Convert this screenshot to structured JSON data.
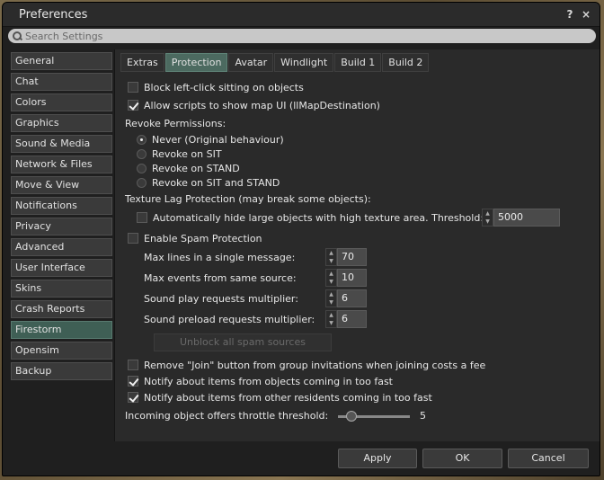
{
  "window": {
    "title": "Preferences",
    "help_label": "?",
    "close_label": "×"
  },
  "search": {
    "placeholder": "Search Settings"
  },
  "sidebar": {
    "items": [
      {
        "label": "General"
      },
      {
        "label": "Chat"
      },
      {
        "label": "Colors"
      },
      {
        "label": "Graphics"
      },
      {
        "label": "Sound & Media"
      },
      {
        "label": "Network & Files"
      },
      {
        "label": "Move & View"
      },
      {
        "label": "Notifications"
      },
      {
        "label": "Privacy"
      },
      {
        "label": "Advanced"
      },
      {
        "label": "User Interface"
      },
      {
        "label": "Skins"
      },
      {
        "label": "Crash Reports"
      },
      {
        "label": "Firestorm"
      },
      {
        "label": "Opensim"
      },
      {
        "label": "Backup"
      }
    ],
    "selected": "Firestorm"
  },
  "tabs": {
    "items": [
      {
        "label": "Extras"
      },
      {
        "label": "Protection"
      },
      {
        "label": "Avatar"
      },
      {
        "label": "Windlight"
      },
      {
        "label": "Build 1"
      },
      {
        "label": "Build 2"
      }
    ],
    "selected": "Protection"
  },
  "protection": {
    "block_left_click": {
      "label": "Block left-click sitting on objects",
      "checked": false
    },
    "allow_map_ui": {
      "label": "Allow scripts to show map UI (llMapDestination)",
      "checked": true
    },
    "revoke_heading": "Revoke Permissions:",
    "revoke_options": [
      {
        "label": "Never (Original behaviour)",
        "selected": true
      },
      {
        "label": "Revoke on SIT",
        "selected": false
      },
      {
        "label": "Revoke on STAND",
        "selected": false
      },
      {
        "label": "Revoke on SIT and STAND",
        "selected": false
      }
    ],
    "texture_heading": "Texture Lag Protection (may break some objects):",
    "auto_hide": {
      "label": "Automatically hide large objects with high texture area. Threshold:",
      "checked": false
    },
    "threshold_value": "5000",
    "spam": {
      "label": "Enable Spam Protection",
      "checked": false
    },
    "spam_fields": [
      {
        "label": "Max lines in a single message:",
        "value": "70"
      },
      {
        "label": "Max events from same source:",
        "value": "10"
      },
      {
        "label": "Sound play requests multiplier:",
        "value": "6"
      },
      {
        "label": "Sound preload requests multiplier:",
        "value": "6"
      }
    ],
    "unblock_label": "Unblock all spam sources",
    "remove_join": {
      "label": "Remove \"Join\" button from group invitations when joining costs a fee",
      "checked": false
    },
    "notify_objects": {
      "label": "Notify about items from objects coming in too fast",
      "checked": true
    },
    "notify_residents": {
      "label": "Notify about items from other residents coming in too fast",
      "checked": true
    },
    "throttle_label": "Incoming object offers throttle threshold:",
    "throttle_value": "5",
    "throttle_level": 0.2
  },
  "footer": {
    "apply_label": "Apply",
    "ok_label": "OK",
    "cancel_label": "Cancel"
  },
  "colors": {
    "accent": "#4c6a60",
    "panel": "#2a2a2a",
    "window": "#1f1f1f"
  }
}
